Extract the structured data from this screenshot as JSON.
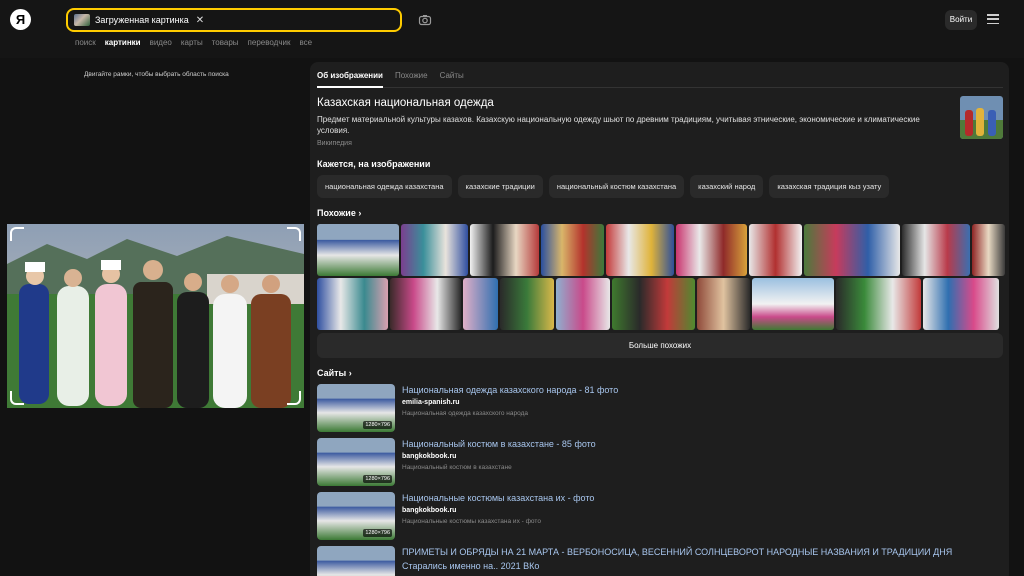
{
  "header": {
    "logo": "Я",
    "search_chip": "Загруженная картинка",
    "login": "Войти",
    "tabs": [
      "поиск",
      "картинки",
      "видео",
      "карты",
      "товары",
      "переводчик",
      "все"
    ],
    "active_tab": "картинки"
  },
  "crop": {
    "hint": "Двигайте рамки, чтобы выбрать область поиска"
  },
  "panel": {
    "tabs": [
      "Об изображении",
      "Похожие",
      "Сайты"
    ],
    "active_tab": "Об изображении",
    "title": "Казахская национальная одежда",
    "description": "Предмет материальной культуры казахов. Казахскую национальную одежду шьют по древним традициям, учитывая этнические, экономические и климатические условия.",
    "source": "Википедия",
    "seems_heading": "Кажется, на изображении",
    "tags": [
      "национальная одежда казахстана",
      "казахские традиции",
      "национальный костюм казахстана",
      "казахский народ",
      "казахская традиция кыз узату"
    ],
    "similar_heading": "Похожие",
    "more_button": "Больше похожих",
    "sites_heading": "Сайты",
    "sites": [
      {
        "title": "Национальная одежда казахского народа - 81 фото",
        "domain": "emilia-spanish.ru",
        "snippet": "Национальная одежда казахского народа",
        "size": "1280×796"
      },
      {
        "title": "Национальный костюм в казахстане - 85 фото",
        "domain": "bangkokbook.ru",
        "snippet": "Национальный костюм в казахстане",
        "size": "1280×796"
      },
      {
        "title": "Национальные костюмы казахстана их - фото",
        "domain": "bangkokbook.ru",
        "snippet": "Национальные костюмы казахстана их - фото",
        "size": "1280×796"
      },
      {
        "title": "ПРИМЕТЫ И ОБРЯДЫ НА 21 МАРТА - ВЕРБОНОСИЦА, ВЕСЕННИЙ СОЛНЦЕВОРОТ НАРОДНЫЕ НАЗВАНИЯ И ТРАДИЦИИ ДНЯ",
        "domain": "Старались именно на.. 2021 ВКо",
        "snippet": "",
        "size": ""
      }
    ]
  }
}
